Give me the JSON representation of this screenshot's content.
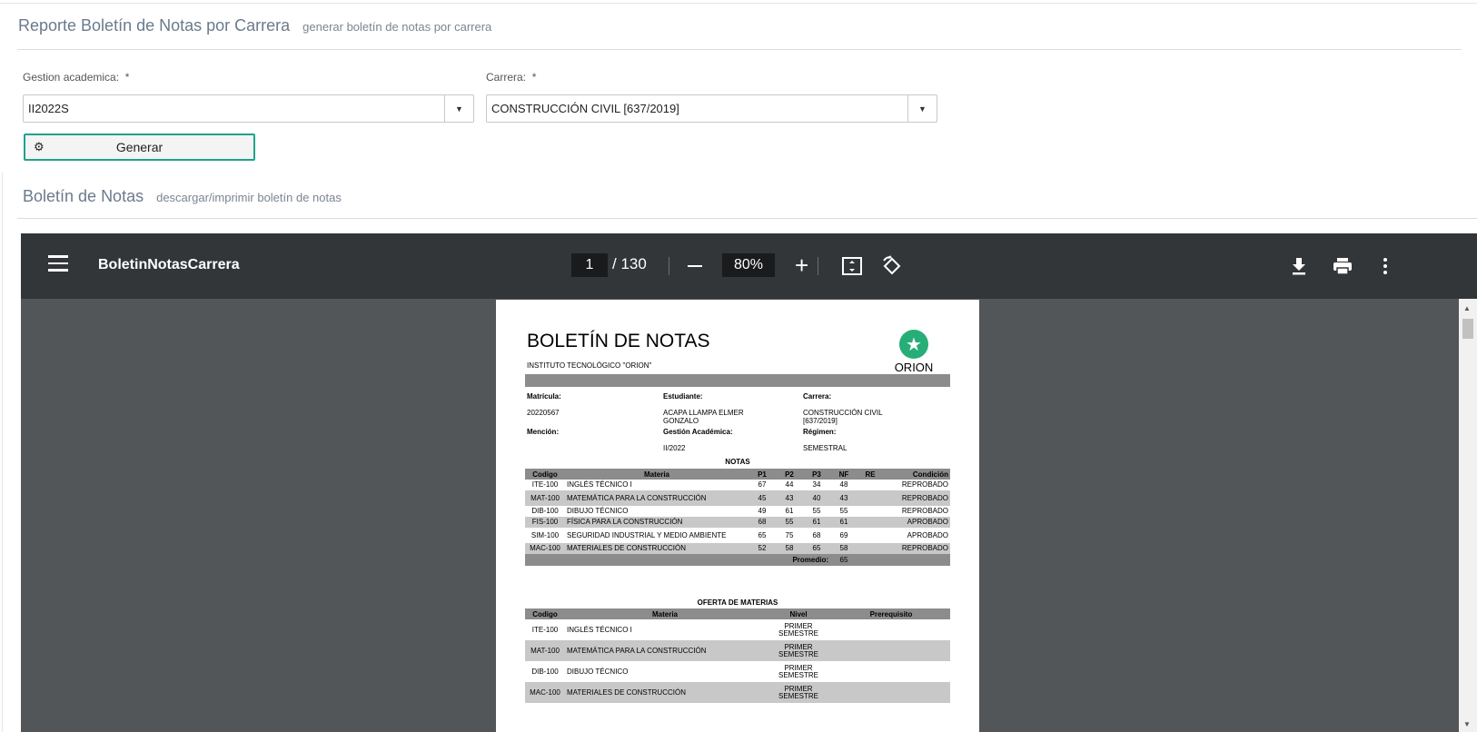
{
  "header1": {
    "title": "Reporte Boletín de Notas por Carrera",
    "subtitle": "generar boletín de notas por carrera"
  },
  "form": {
    "gestion_label": "Gestion academica:",
    "gestion_required": "*",
    "gestion_value": "II2022S",
    "carrera_label": "Carrera:",
    "carrera_required": "*",
    "carrera_value": "CONSTRUCCIÓN CIVIL [637/2019]",
    "generate_button": "Generar"
  },
  "header2": {
    "title": "Boletín de Notas",
    "subtitle": "descargar/imprimir boletín de notas"
  },
  "viewer": {
    "filename": "BoletinNotasCarrera",
    "current_page": "1",
    "total_pages": "/ 130",
    "zoom": "80%",
    "icons": [
      "menu-icon",
      "zoom-out-icon",
      "zoom-in-icon",
      "fit-page-icon",
      "rotate-icon",
      "download-icon",
      "print-icon",
      "more-vert-icon"
    ]
  },
  "document": {
    "title": "BOLETÍN DE NOTAS",
    "institute": "INSTITUTO TECNOLÓGICO  \"ORION\"",
    "logo_text": "ORION",
    "matricula_label": "Matrícula:",
    "matricula": "20220567",
    "estudiante_label": "Estudiante:",
    "estudiante": "ACAPA LLAMPA ELMER GONZALO",
    "carrera_label": "Carrera:",
    "carrera": "CONSTRUCCIÓN CIVIL [637/2019]",
    "mencion_label": "Mención:",
    "gestion_label": "Gestión Académica:",
    "gestion": "II/2022",
    "regimen_label": "Régimen:",
    "regimen": "SEMESTRAL",
    "notas_title": "NOTAS",
    "notas_headers": [
      "Codigo",
      "Materia",
      "P1",
      "P2",
      "P3",
      "NF",
      "RE",
      "Condición"
    ],
    "notas_rows": [
      [
        "ITE-100",
        "INGLÉS TÉCNICO I",
        "67",
        "44",
        "34",
        "48",
        "",
        "REPROBADO"
      ],
      [
        "MAT-100",
        "MATEMÁTICA PARA LA CONSTRUCCIÓN",
        "45",
        "43",
        "40",
        "43",
        "",
        "REPROBADO"
      ],
      [
        "DIB-100",
        "DIBUJO TÉCNICO",
        "49",
        "61",
        "55",
        "55",
        "",
        "REPROBADO"
      ],
      [
        "FIS-100",
        "FÍSICA PARA LA CONSTRUCCIÓN",
        "68",
        "55",
        "61",
        "61",
        "",
        "APROBADO"
      ],
      [
        "SIM-100",
        "SEGURIDAD INDUSTRIAL Y MEDIO AMBIENTE",
        "65",
        "75",
        "68",
        "69",
        "",
        "APROBADO"
      ],
      [
        "MAC-100",
        "MATERIALES DE CONSTRUCCIÓN",
        "52",
        "58",
        "65",
        "58",
        "",
        "REPROBADO"
      ]
    ],
    "promedio_label": "Promedio:",
    "promedio": "65",
    "oferta_title": "OFERTA DE MATERIAS",
    "oferta_headers": [
      "Codigo",
      "Materia",
      "Nivel",
      "Prerequisito"
    ],
    "oferta_rows": [
      [
        "ITE-100",
        "INGLÉS TÉCNICO I",
        "PRIMER SEMESTRE",
        ""
      ],
      [
        "MAT-100",
        "MATEMÁTICA PARA LA CONSTRUCCIÓN",
        "PRIMER SEMESTRE",
        ""
      ],
      [
        "DIB-100",
        "DIBUJO TÉCNICO",
        "PRIMER SEMESTRE",
        ""
      ],
      [
        "MAC-100",
        "MATERIALES DE CONSTRUCCIÓN",
        "PRIMER SEMESTRE",
        ""
      ]
    ]
  },
  "colors": {
    "accent": "#1fa38c",
    "viewer_bg": "#525659",
    "toolbar_bg": "#323639",
    "logo_green": "#27ae78"
  }
}
